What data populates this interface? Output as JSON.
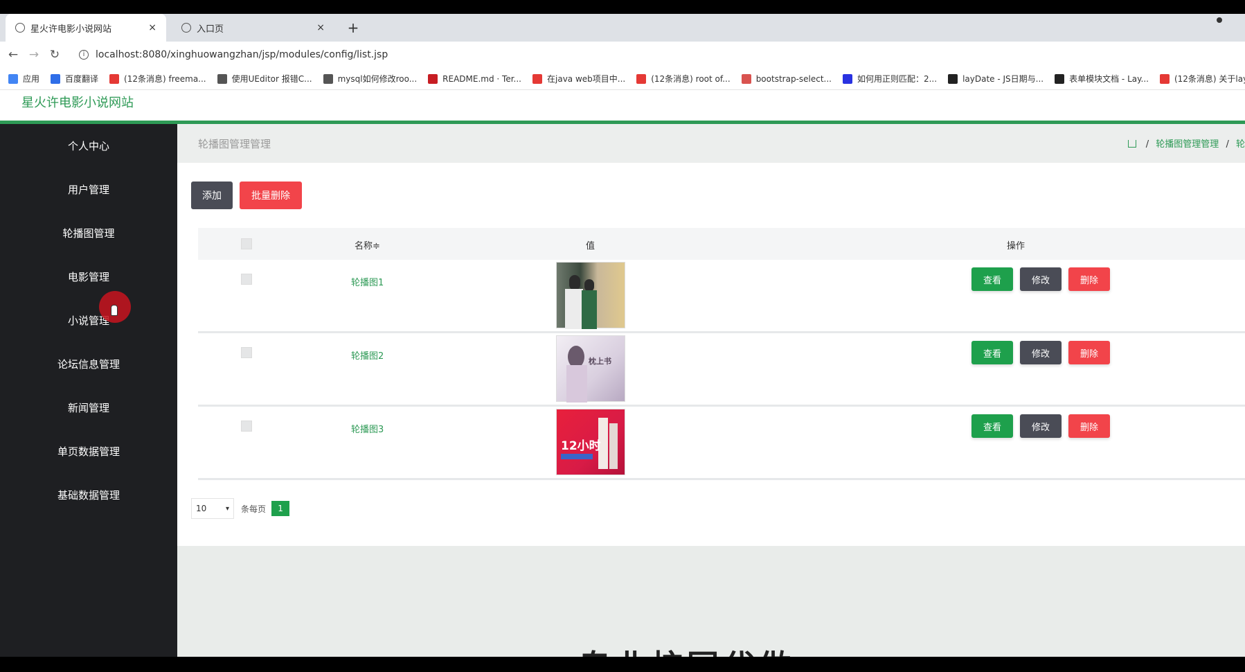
{
  "browser": {
    "tabs": [
      {
        "title": "星火许电影小说网站",
        "close": "×"
      },
      {
        "title": "入口页",
        "close": "×"
      }
    ],
    "new_tab": "+",
    "back": "←",
    "forward": "→",
    "reload": "↻",
    "url": "localhost:8080/xinghuowangzhan/jsp/modules/config/list.jsp",
    "bookmarks": [
      {
        "label": "应用",
        "icon": "apps-icon",
        "color": "#4285f4"
      },
      {
        "label": "百度翻译",
        "icon": "baidu-icon",
        "color": "#2f6ee8"
      },
      {
        "label": "(12条消息) freema...",
        "icon": "csdn-icon",
        "color": "#e53935"
      },
      {
        "label": "使用UEditor 报错C...",
        "icon": "link-icon",
        "color": "#555"
      },
      {
        "label": "mysql如何修改roo...",
        "icon": "link-icon",
        "color": "#555"
      },
      {
        "label": "README.md · Ter...",
        "icon": "gitee-icon",
        "color": "#c71d23"
      },
      {
        "label": "在java web项目中...",
        "icon": "csdn-icon",
        "color": "#e53935"
      },
      {
        "label": "(12条消息) root of...",
        "icon": "csdn-icon",
        "color": "#e53935"
      },
      {
        "label": "bootstrap-select...",
        "icon": "bootstrap-icon",
        "color": "#d9534f"
      },
      {
        "label": "如何用正则匹配：2...",
        "icon": "baidu-paw-icon",
        "color": "#2932e1"
      },
      {
        "label": "layDate - JS日期与...",
        "icon": "layui-icon",
        "color": "#222"
      },
      {
        "label": "表单模块文档 - Lay...",
        "icon": "layui-icon",
        "color": "#222"
      },
      {
        "label": "(12条消息) 关于lay",
        "icon": "csdn-icon",
        "color": "#e53935"
      }
    ]
  },
  "app": {
    "brand": "星火许电影小说网站",
    "accent": "#2e9a56"
  },
  "sidebar": {
    "items": [
      {
        "label": "个人中心"
      },
      {
        "label": "用户管理"
      },
      {
        "label": "轮播图管理"
      },
      {
        "label": "电影管理"
      },
      {
        "label": "小说管理"
      },
      {
        "label": "论坛信息管理"
      },
      {
        "label": "新闻管理"
      },
      {
        "label": "单页数据管理"
      },
      {
        "label": "基础数据管理"
      }
    ]
  },
  "page": {
    "title": "轮播图管理管理",
    "breadcrumb": [
      "轮播图管理管理",
      "轮"
    ],
    "add_button": "添加",
    "batch_delete_button": "批量删除",
    "table": {
      "headers": {
        "name": "名称≑",
        "value": "值",
        "actions": "操作"
      },
      "rows": [
        {
          "name": "轮播图1",
          "thumb_text": ""
        },
        {
          "name": "轮播图2",
          "thumb_text": "枕上书"
        },
        {
          "name": "轮播图3",
          "thumb_text": "12小时"
        }
      ],
      "actions": {
        "view": "查看",
        "edit": "修改",
        "delete": "删除"
      }
    },
    "pager": {
      "page_size": "10",
      "per_page_label": "条每页",
      "current_page": "1"
    },
    "footer_text": "专业校园代做"
  }
}
